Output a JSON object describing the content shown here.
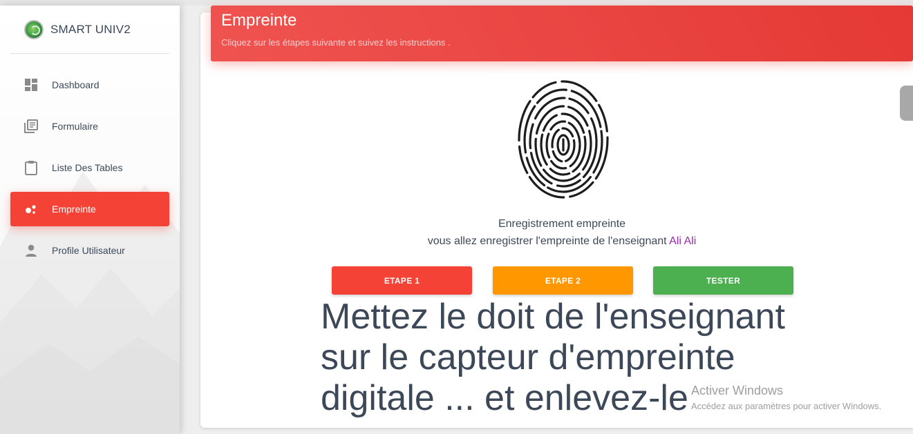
{
  "brand": {
    "name": "SMART UNIV2"
  },
  "sidebar": {
    "items": [
      {
        "label": "Dashboard",
        "icon": "dashboard-icon",
        "active": false
      },
      {
        "label": "Formulaire",
        "icon": "library-books-icon",
        "active": false
      },
      {
        "label": "Liste Des Tables",
        "icon": "clipboard-icon",
        "active": false
      },
      {
        "label": "Empreinte",
        "icon": "bubble-chart-icon",
        "active": true
      },
      {
        "label": "Profile Utilisateur",
        "icon": "person-icon",
        "active": false
      }
    ]
  },
  "header": {
    "title": "Empreinte",
    "subtitle": "Cliquez sur les étapes suivante et suivez les instructions ."
  },
  "content": {
    "line1": "Enregistrement empreinte",
    "line2_prefix": "vous allez enregistrer l'empreinte de l'enseignant ",
    "teacher_name": "Ali Ali",
    "buttons": {
      "step1": "ETAPE 1",
      "step2": "ETAPE 2",
      "test": "TESTER"
    },
    "instruction": "Mettez le doit de l'enseignant sur le capteur d'empreinte digitale ... et enlevez-le"
  },
  "watermark": {
    "title": "Activer Windows",
    "subtitle": "Accédez aux paramètres pour activer Windows."
  },
  "colors": {
    "accent_red": "#f44336",
    "orange": "#ff9800",
    "green": "#4caf50",
    "name_purple": "#9c27b0",
    "text": "#3c4858"
  }
}
